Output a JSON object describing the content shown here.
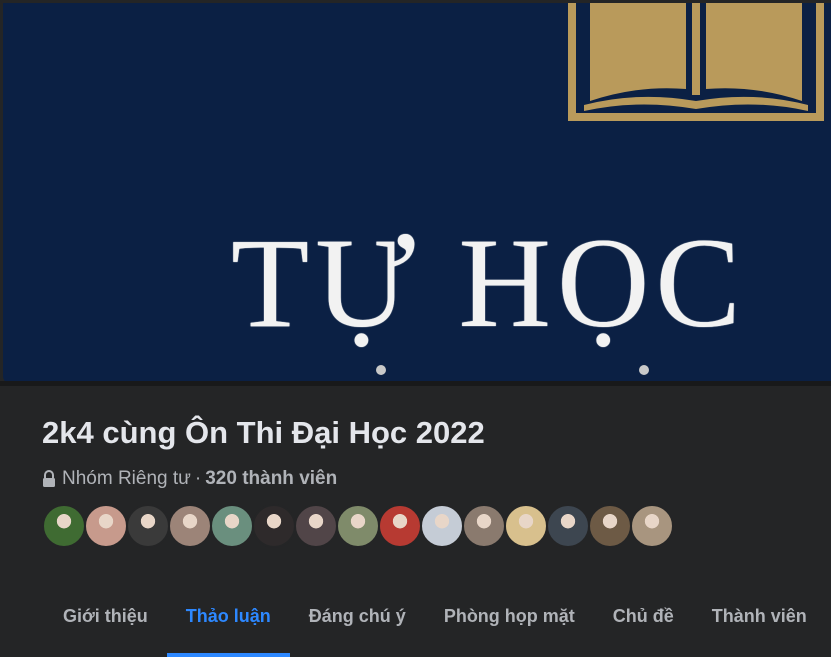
{
  "cover": {
    "text": "TỰ HỌC"
  },
  "group": {
    "title": "2k4 cùng Ôn Thi Đại Học 2022",
    "privacy": "Nhóm Riêng tư",
    "separator": "·",
    "members": "320 thành viên"
  },
  "avatars": [
    {
      "color": "#3f6b32"
    },
    {
      "color": "#c79a8c"
    },
    {
      "color": "#3a3a3a"
    },
    {
      "color": "#9c8478"
    },
    {
      "color": "#6a8f7e"
    },
    {
      "color": "#2e2a2b"
    },
    {
      "color": "#514548"
    },
    {
      "color": "#7f8b6a"
    },
    {
      "color": "#b73a32"
    },
    {
      "color": "#c5ccd6"
    },
    {
      "color": "#8a7a6e"
    },
    {
      "color": "#d8c08d"
    },
    {
      "color": "#3d4650"
    },
    {
      "color": "#6d5a45"
    },
    {
      "color": "#a8957f"
    }
  ],
  "tabs": [
    {
      "label": "Giới thiệu",
      "active": false
    },
    {
      "label": "Thảo luận",
      "active": true
    },
    {
      "label": "Đáng chú ý",
      "active": false
    },
    {
      "label": "Phòng họp mặt",
      "active": false
    },
    {
      "label": "Chủ đề",
      "active": false
    },
    {
      "label": "Thành viên",
      "active": false
    }
  ],
  "colors": {
    "background": "#242526",
    "cover_bg": "#0b2044",
    "gold": "#b99a5b",
    "accent": "#2d88ff",
    "text_primary": "#e4e6eb",
    "text_secondary": "#b0b3b8"
  }
}
